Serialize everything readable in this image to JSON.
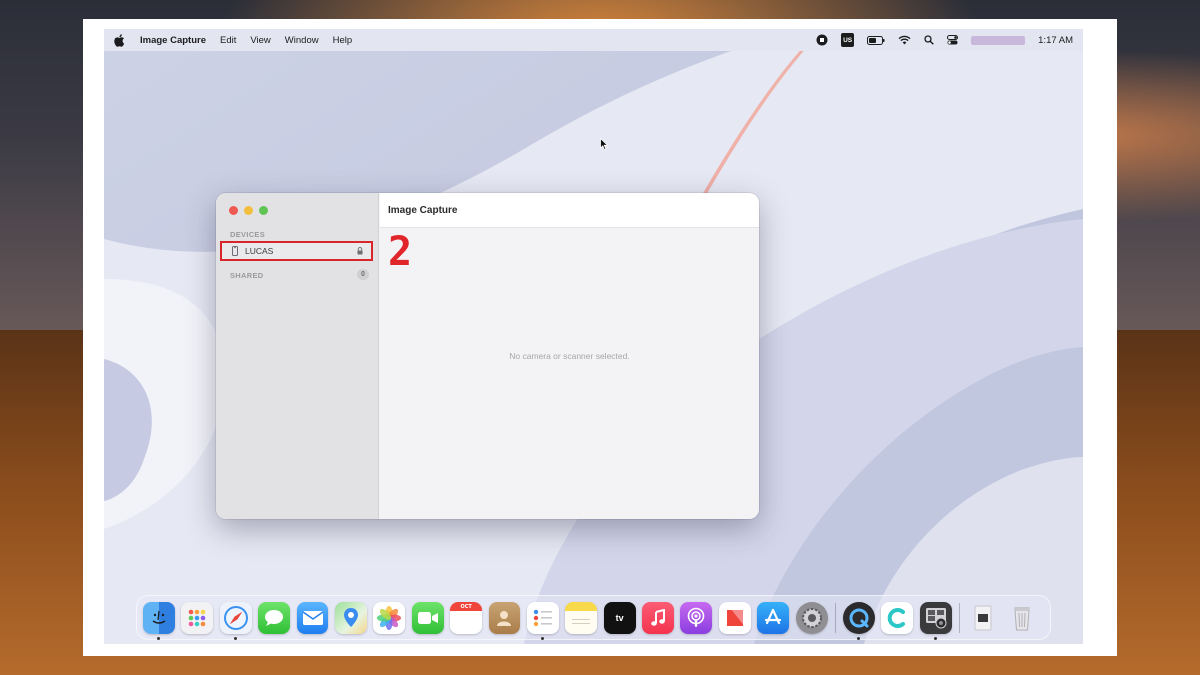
{
  "menubar": {
    "app_name": "Image Capture",
    "items": [
      "Edit",
      "View",
      "Window",
      "Help"
    ],
    "keyboard_layout": "US",
    "clock": "1:17 AM"
  },
  "window": {
    "title": "Image Capture",
    "sidebar": {
      "devices_label": "DEVICES",
      "device_name": "LUCAS",
      "shared_label": "SHARED",
      "shared_count": "0"
    },
    "empty_message": "No camera or scanner selected."
  },
  "annotation": {
    "step_number": "2",
    "highlight_color": "#d8262c"
  },
  "dock": {
    "apps": [
      {
        "name": "Finder",
        "icon": "finder-icon",
        "running": true
      },
      {
        "name": "Launchpad",
        "icon": "launchpad-icon",
        "running": false
      },
      {
        "name": "Safari",
        "icon": "safari-icon",
        "running": true
      },
      {
        "name": "Messages",
        "icon": "messages-icon",
        "running": false
      },
      {
        "name": "Mail",
        "icon": "mail-icon",
        "running": false
      },
      {
        "name": "Maps",
        "icon": "maps-icon",
        "running": false
      },
      {
        "name": "Photos",
        "icon": "photos-icon",
        "running": false
      },
      {
        "name": "FaceTime",
        "icon": "facetime-icon",
        "running": false
      },
      {
        "name": "Calendar",
        "icon": "calendar-icon",
        "running": false,
        "month": "OCT"
      },
      {
        "name": "Contacts",
        "icon": "contacts-icon",
        "running": false
      },
      {
        "name": "Reminders",
        "icon": "reminders-icon",
        "running": true
      },
      {
        "name": "Notes",
        "icon": "notes-icon",
        "running": false
      },
      {
        "name": "Apple TV",
        "icon": "tv-icon",
        "running": false,
        "label": "tv"
      },
      {
        "name": "Music",
        "icon": "music-icon",
        "running": false
      },
      {
        "name": "Podcasts",
        "icon": "podcasts-icon",
        "running": false
      },
      {
        "name": "News",
        "icon": "news-icon",
        "running": false
      },
      {
        "name": "App Store",
        "icon": "appstore-icon",
        "running": false
      },
      {
        "name": "System Preferences",
        "icon": "system-preferences-icon",
        "running": false
      },
      {
        "name": "QuickTime Player",
        "icon": "quicktime-icon",
        "running": true
      },
      {
        "name": "Canva",
        "icon": "canva-icon",
        "running": false
      },
      {
        "name": "Image Capture",
        "icon": "image-capture-icon",
        "running": true
      },
      {
        "name": "Downloads",
        "icon": "downloads-stack-icon",
        "running": false
      },
      {
        "name": "Trash",
        "icon": "trash-icon",
        "running": false
      }
    ]
  }
}
